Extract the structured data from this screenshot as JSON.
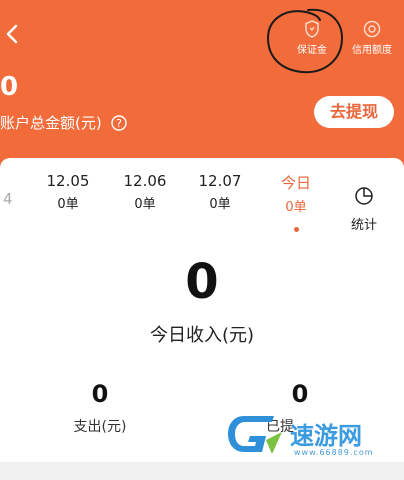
{
  "header": {
    "deposit_label": "保证金",
    "credit_label": "信用额度",
    "total_amount": "0",
    "total_label": "账户总金额(元)",
    "withdraw_label": "去提现"
  },
  "tabs": [
    {
      "date": "12.05",
      "count": "0单"
    },
    {
      "date": "12.06",
      "count": "0单"
    },
    {
      "date": "12.07",
      "count": "0单"
    },
    {
      "date": "今日",
      "count": "0单"
    }
  ],
  "tab_partial": "4",
  "stats_label": "统计",
  "today": {
    "income_value": "0",
    "income_label": "今日收入(元)"
  },
  "expense": {
    "value": "0",
    "label": "支出(元)"
  },
  "withdrawn": {
    "value": "0",
    "label": "已提"
  },
  "watermark": {
    "text": "速游网",
    "url": "www.66889.com"
  },
  "colors": {
    "brand": "#f26b3a",
    "accent": "#e8663a"
  }
}
